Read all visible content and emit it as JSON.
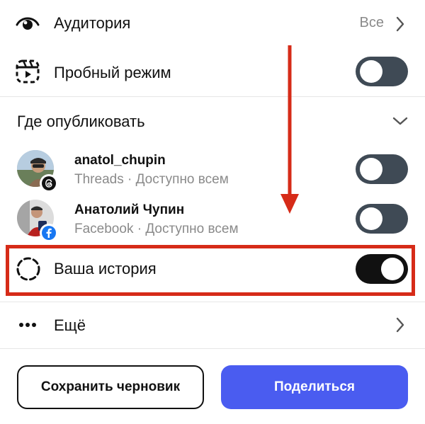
{
  "audience": {
    "label": "Аудитория",
    "value": "Все"
  },
  "trial": {
    "label": "Пробный режим",
    "enabled": false
  },
  "publish": {
    "heading": "Где опубликовать"
  },
  "accounts": [
    {
      "name": "anatol_chupin",
      "platform": "Threads",
      "visibility": "Доступно всем",
      "sub": "Threads · Доступно всем",
      "enabled": false
    },
    {
      "name": "Анатолий Чупин",
      "platform": "Facebook",
      "visibility": "Доступно всем",
      "sub": "Facebook · Доступно всем",
      "enabled": false
    }
  ],
  "story": {
    "label": "Ваша история",
    "enabled": true
  },
  "more": {
    "label": "Ещё"
  },
  "buttons": {
    "save_draft": "Сохранить черновик",
    "share": "Поделиться"
  },
  "colors": {
    "accent": "#4a5cf0",
    "highlight": "#d62b18",
    "toggle_off": "#3f4a55",
    "toggle_on": "#111111",
    "facebook": "#1877f2"
  }
}
